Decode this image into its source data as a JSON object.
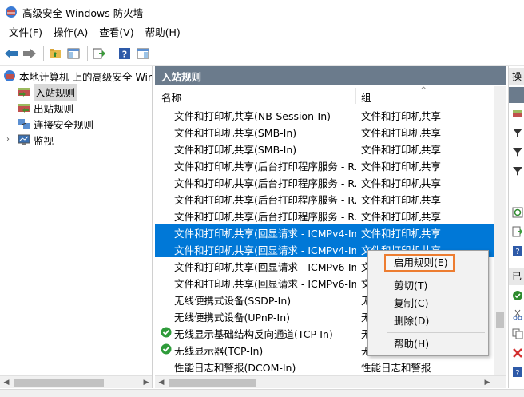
{
  "window": {
    "title": "高级安全 Windows 防火墙"
  },
  "menu": [
    {
      "label": "文件(F)"
    },
    {
      "label": "操作(A)"
    },
    {
      "label": "查看(V)"
    },
    {
      "label": "帮助(H)"
    }
  ],
  "toolbar": {
    "icons": [
      "back-arrow-icon",
      "forward-arrow-icon",
      "up-folder-icon",
      "show-hide-tree-icon",
      "export-list-icon",
      "help-icon",
      "properties-icon"
    ]
  },
  "tree": {
    "root": "本地计算机 上的高级安全 Windows 防火墙",
    "items": [
      {
        "label": "入站规则",
        "selected": true
      },
      {
        "label": "出站规则",
        "selected": false
      },
      {
        "label": "连接安全规则",
        "selected": false
      },
      {
        "label": "监视",
        "selected": false
      }
    ]
  },
  "center": {
    "title": "入站规则",
    "columns": {
      "name": "名称",
      "group": "组"
    },
    "rows": [
      {
        "name": "文件和打印机共享(NB-Session-In)",
        "group": "文件和打印机共享",
        "enabled": false,
        "selected": false
      },
      {
        "name": "文件和打印机共享(SMB-In)",
        "group": "文件和打印机共享",
        "enabled": false,
        "selected": false
      },
      {
        "name": "文件和打印机共享(SMB-In)",
        "group": "文件和打印机共享",
        "enabled": false,
        "selected": false
      },
      {
        "name": "文件和打印机共享(后台打印程序服务 - R...",
        "group": "文件和打印机共享",
        "enabled": false,
        "selected": false
      },
      {
        "name": "文件和打印机共享(后台打印程序服务 - R...",
        "group": "文件和打印机共享",
        "enabled": false,
        "selected": false
      },
      {
        "name": "文件和打印机共享(后台打印程序服务 - R...",
        "group": "文件和打印机共享",
        "enabled": false,
        "selected": false
      },
      {
        "name": "文件和打印机共享(后台打印程序服务 - R...",
        "group": "文件和打印机共享",
        "enabled": false,
        "selected": false
      },
      {
        "name": "文件和打印机共享(回显请求 - ICMPv4-In)",
        "group": "文件和打印机共享",
        "enabled": false,
        "selected": true
      },
      {
        "name": "文件和打印机共享(回显请求 - ICMPv4-In)",
        "group": "文件和打印机共享",
        "enabled": false,
        "selected": true
      },
      {
        "name": "文件和打印机共享(回显请求 - ICMPv6-In)",
        "group": "文",
        "enabled": false,
        "selected": false
      },
      {
        "name": "文件和打印机共享(回显请求 - ICMPv6-In)",
        "group": "文",
        "enabled": false,
        "selected": false
      },
      {
        "name": "无线便携式设备(SSDP-In)",
        "group": "无",
        "enabled": false,
        "selected": false
      },
      {
        "name": "无线便携式设备(UPnP-In)",
        "group": "无",
        "enabled": false,
        "selected": false
      },
      {
        "name": "无线显示基础结构反向通道(TCP-In)",
        "group": "无",
        "enabled": true,
        "selected": false
      },
      {
        "name": "无线显示器(TCP-In)",
        "group": "无",
        "enabled": true,
        "selected": false
      },
      {
        "name": "性能日志和警报(DCOM-In)",
        "group": "性能日志和警报",
        "enabled": false,
        "selected": false
      }
    ]
  },
  "right": {
    "headers": [
      "操",
      "已"
    ]
  },
  "context_menu": {
    "items": [
      {
        "label": "启用规则(E)",
        "highlighted": true
      },
      {
        "label": "剪切(T)"
      },
      {
        "label": "复制(C)"
      },
      {
        "label": "删除(D)"
      },
      {
        "label": "帮助(H)"
      }
    ]
  },
  "colors": {
    "selection": "#0078d7",
    "pane_header": "#6b7b8c",
    "highlight_border": "#ed7d31"
  }
}
